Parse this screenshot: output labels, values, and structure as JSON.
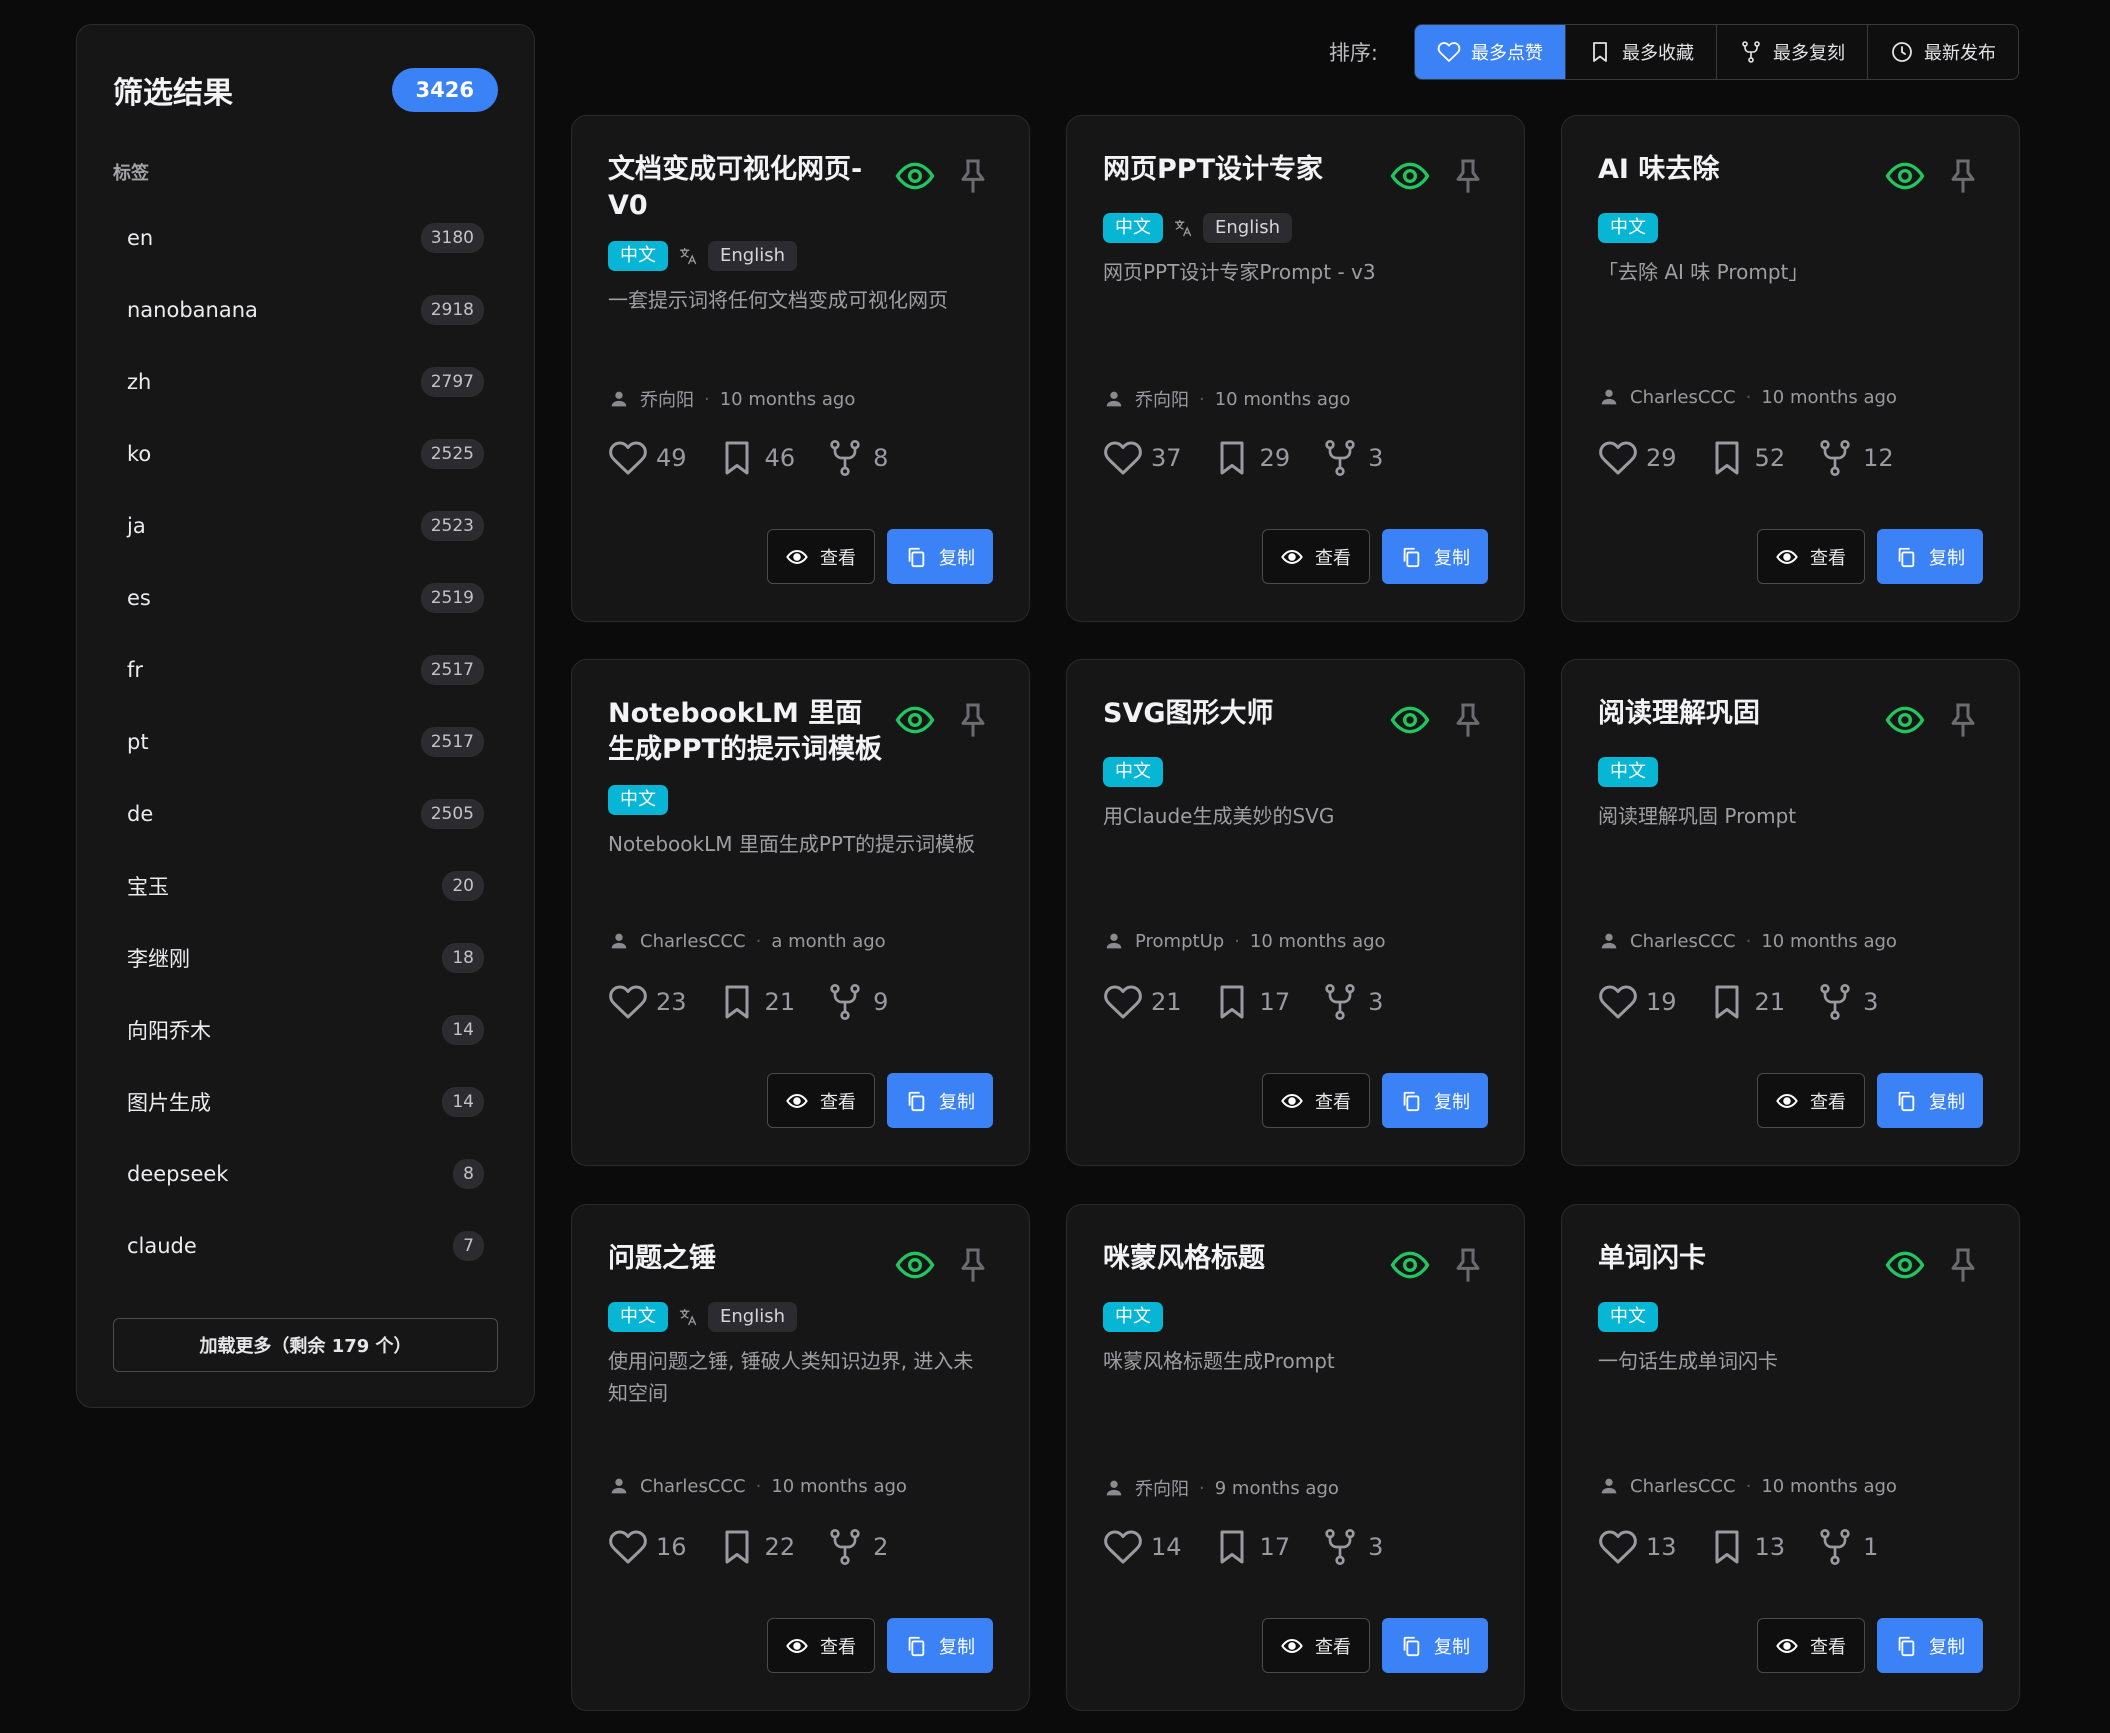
{
  "sidebar": {
    "title": "筛选结果",
    "total": "3426",
    "tags_label": "标签",
    "tags": [
      {
        "name": "en",
        "count": "3180"
      },
      {
        "name": "nanobanana",
        "count": "2918"
      },
      {
        "name": "zh",
        "count": "2797"
      },
      {
        "name": "ko",
        "count": "2525"
      },
      {
        "name": "ja",
        "count": "2523"
      },
      {
        "name": "es",
        "count": "2519"
      },
      {
        "name": "fr",
        "count": "2517"
      },
      {
        "name": "pt",
        "count": "2517"
      },
      {
        "name": "de",
        "count": "2505"
      },
      {
        "name": "宝玉",
        "count": "20"
      },
      {
        "name": "李继刚",
        "count": "18"
      },
      {
        "name": "向阳乔木",
        "count": "14"
      },
      {
        "name": "图片生成",
        "count": "14"
      },
      {
        "name": "deepseek",
        "count": "8"
      },
      {
        "name": "claude",
        "count": "7"
      }
    ],
    "load_more": "加载更多（剩余 179 个）"
  },
  "sort": {
    "label": "排序:",
    "options": [
      {
        "label": "最多点赞",
        "icon": "heart-icon",
        "active": true
      },
      {
        "label": "最多收藏",
        "icon": "bookmark-icon",
        "active": false
      },
      {
        "label": "最多复刻",
        "icon": "fork-icon",
        "active": false
      },
      {
        "label": "最新发布",
        "icon": "clock-icon",
        "active": false
      }
    ]
  },
  "colors": {
    "accent": "#3b82f6",
    "badge_zh": "#06b6d4",
    "eye": "#22c55e"
  },
  "cards": [
    {
      "title": "文档变成可视化网页-V0",
      "zh": "中文",
      "en": "English",
      "desc": "一套提示词将任何文档变成可视化网页",
      "author": "乔向阳",
      "time": "10 months ago",
      "likes": "49",
      "saves": "46",
      "forks": "8",
      "view": "查看",
      "copy": "复制"
    },
    {
      "title": "网页PPT设计专家",
      "zh": "中文",
      "en": "English",
      "desc": "网页PPT设计专家Prompt - v3",
      "author": "乔向阳",
      "time": "10 months ago",
      "likes": "37",
      "saves": "29",
      "forks": "3",
      "view": "查看",
      "copy": "复制"
    },
    {
      "title": "AI 味去除",
      "zh": "中文",
      "en": null,
      "desc": "「去除 AI 味 Prompt」",
      "author": "CharlesCCC",
      "time": "10 months ago",
      "likes": "29",
      "saves": "52",
      "forks": "12",
      "view": "查看",
      "copy": "复制"
    },
    {
      "title": "NotebookLM 里面生成PPT的提示词模板",
      "zh": "中文",
      "en": null,
      "desc": "NotebookLM 里面生成PPT的提示词模板",
      "author": "CharlesCCC",
      "time": "a month ago",
      "likes": "23",
      "saves": "21",
      "forks": "9",
      "view": "查看",
      "copy": "复制"
    },
    {
      "title": "SVG图形大师",
      "zh": "中文",
      "en": null,
      "desc": "用Claude生成美妙的SVG",
      "author": "PromptUp",
      "time": "10 months ago",
      "likes": "21",
      "saves": "17",
      "forks": "3",
      "view": "查看",
      "copy": "复制"
    },
    {
      "title": "阅读理解巩固",
      "zh": "中文",
      "en": null,
      "desc": "阅读理解巩固 Prompt",
      "author": "CharlesCCC",
      "time": "10 months ago",
      "likes": "19",
      "saves": "21",
      "forks": "3",
      "view": "查看",
      "copy": "复制"
    },
    {
      "title": "问题之锤",
      "zh": "中文",
      "en": "English",
      "desc": "使用问题之锤, 锤破人类知识边界, 进入未知空间",
      "author": "CharlesCCC",
      "time": "10 months ago",
      "likes": "16",
      "saves": "22",
      "forks": "2",
      "view": "查看",
      "copy": "复制"
    },
    {
      "title": "咪蒙风格标题",
      "zh": "中文",
      "en": null,
      "desc": "咪蒙风格标题生成Prompt",
      "author": "乔向阳",
      "time": "9 months ago",
      "likes": "14",
      "saves": "17",
      "forks": "3",
      "view": "查看",
      "copy": "复制"
    },
    {
      "title": "单词闪卡",
      "zh": "中文",
      "en": null,
      "desc": "一句话生成单词闪卡",
      "author": "CharlesCCC",
      "time": "10 months ago",
      "likes": "13",
      "saves": "13",
      "forks": "1",
      "view": "查看",
      "copy": "复制"
    }
  ]
}
